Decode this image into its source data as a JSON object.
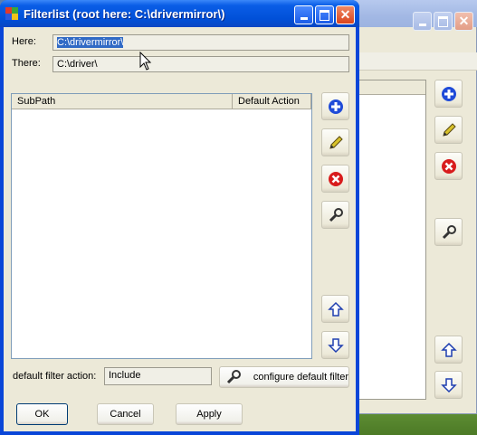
{
  "main_window": {
    "title": "Filterlist (root here: C:\\drivermirror\\)",
    "here_label": "Here:",
    "here_value": "C:\\drivermirror\\",
    "there_label": "There:",
    "there_value": "C:\\driver\\",
    "columns": [
      "SubPath",
      "Default Action"
    ],
    "default_filter_label": "default filter action:",
    "default_filter_value": "Include",
    "configure_label": "configure default filter",
    "ok_label": "OK",
    "cancel_label": "Cancel",
    "apply_label": "Apply"
  },
  "icons": {
    "add": "add-icon",
    "edit": "pencil-icon",
    "remove": "remove-icon",
    "configure": "wrench-icon",
    "up": "arrow-up-icon",
    "down": "arrow-down-icon"
  },
  "colors": {
    "titlebar": "#0050d8",
    "face": "#ece9d8",
    "selection": "#316ac5",
    "close_button": "#d9441d",
    "add_icon": "#1f4bd8",
    "remove_icon": "#d81c1c"
  }
}
